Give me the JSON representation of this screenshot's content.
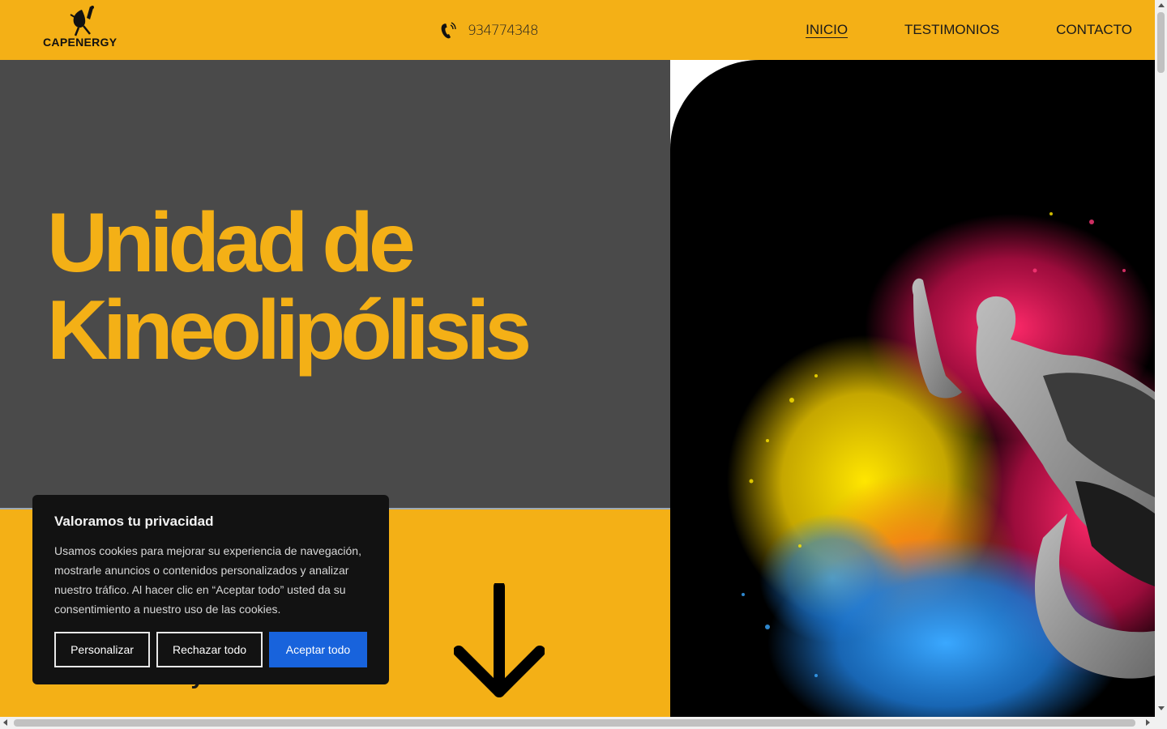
{
  "header": {
    "logo_text": "CAPENERGY",
    "phone": "934774348",
    "nav": [
      {
        "label": "INICIO",
        "active": true
      },
      {
        "label": "TESTIMONIOS",
        "active": false
      },
      {
        "label": "CONTACTO",
        "active": false
      }
    ]
  },
  "hero": {
    "title_line1": "Unidad de",
    "title_line2": "Kineolipólisis",
    "subtitle_partial": "Subcutánea y Visceral."
  },
  "cookie_banner": {
    "title": "Valoramos tu privacidad",
    "text": "Usamos cookies para mejorar su experiencia de navegación, mostrarle anuncios o contenidos personalizados y analizar nuestro tráfico. Al hacer clic en “Aceptar todo” usted da su consentimiento a nuestro uso de las cookies.",
    "buttons": {
      "customize": "Personalizar",
      "reject": "Rechazar todo",
      "accept": "Aceptar todo"
    }
  },
  "colors": {
    "brand_yellow": "#F4B016",
    "hero_gray": "#4A4A4A",
    "accept_blue": "#1863DC",
    "cookie_bg": "#121212"
  },
  "icons": [
    "runner-logo-icon",
    "phone-icon",
    "arrow-down-icon"
  ]
}
